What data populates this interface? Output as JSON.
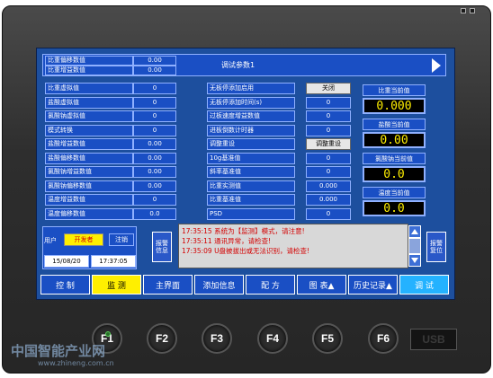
{
  "header": {
    "param_rows": [
      {
        "label": "比重偏移数值",
        "value": "0.00"
      },
      {
        "label": "比重增益数值",
        "value": "0.00"
      }
    ],
    "title": "调试参数1",
    "next_arrow": "play-right-icon"
  },
  "left_params": [
    {
      "label": "比重虚拟值",
      "value": "0"
    },
    {
      "label": "盐酸虚拟值",
      "value": "0"
    },
    {
      "label": "氯酸钠虚拟值",
      "value": "0"
    },
    {
      "label": "模式转换",
      "value": "0"
    },
    {
      "label": "盐酸增益数值",
      "value": "0.00"
    },
    {
      "label": "盐酸偏移数值",
      "value": "0.00"
    },
    {
      "label": "氯酸钠增益数值",
      "value": "0.00"
    },
    {
      "label": "氯酸钠偏移数值",
      "value": "0.00"
    },
    {
      "label": "温度增益数值",
      "value": "0"
    },
    {
      "label": "温度偏移数值",
      "value": "0.0"
    }
  ],
  "mid_params": [
    {
      "label": "无板停添加启用",
      "value": "关闭",
      "is_button": true
    },
    {
      "label": "无板停添加时间(s)",
      "value": "0"
    },
    {
      "label": "过板速度增益数值",
      "value": "0"
    },
    {
      "label": "进板倒数计时器",
      "value": "0"
    },
    {
      "label": "调整重设",
      "value": "调整重设",
      "is_button": true
    },
    {
      "label": "10g基准值",
      "value": "0"
    },
    {
      "label": "斜率基准值",
      "value": "0"
    },
    {
      "label": "比重实测值",
      "value": "0.000"
    },
    {
      "label": "比重基准值",
      "value": "0.000"
    },
    {
      "label": "PSD",
      "value": "0"
    }
  ],
  "current_values": [
    {
      "title": "比重当前值",
      "value": "0.000"
    },
    {
      "title": "盐酸当前值",
      "value": "0.00"
    },
    {
      "title": "氯酸钠当前值",
      "value": "0.0"
    },
    {
      "title": "温度当前值",
      "value": "0.0"
    }
  ],
  "user": {
    "label": "用户",
    "name": "开发者",
    "logout": "注销",
    "date": "15/08/20",
    "time": "17:37:05"
  },
  "alarm": {
    "info_button": "报警\n信息",
    "reset_button": "报警\n复位",
    "messages": [
      "17:35:15 系统为【监测】模式，请注意!",
      "17:35:11 通讯异常，请检查!",
      "17:35:09 U盘被拔出或无法识别，请检查!"
    ],
    "scroll_up_icon": "triangle-up-icon",
    "scroll_down_icon": "triangle-down-icon"
  },
  "nav": [
    {
      "label": "控  制"
    },
    {
      "label": "监  测",
      "active": true
    },
    {
      "label": "主界面"
    },
    {
      "label": "添加信息"
    },
    {
      "label": "配  方"
    },
    {
      "label": "图  表▲"
    },
    {
      "label": "历史记录▲"
    },
    {
      "label": "调  试",
      "cyan": true
    }
  ],
  "fkeys": [
    "F1",
    "F2",
    "F3",
    "F4",
    "F5",
    "F6"
  ],
  "usb_label": "USB",
  "watermark": {
    "text": "中国智能产业网",
    "url": "www.zhineng.com.cn"
  }
}
